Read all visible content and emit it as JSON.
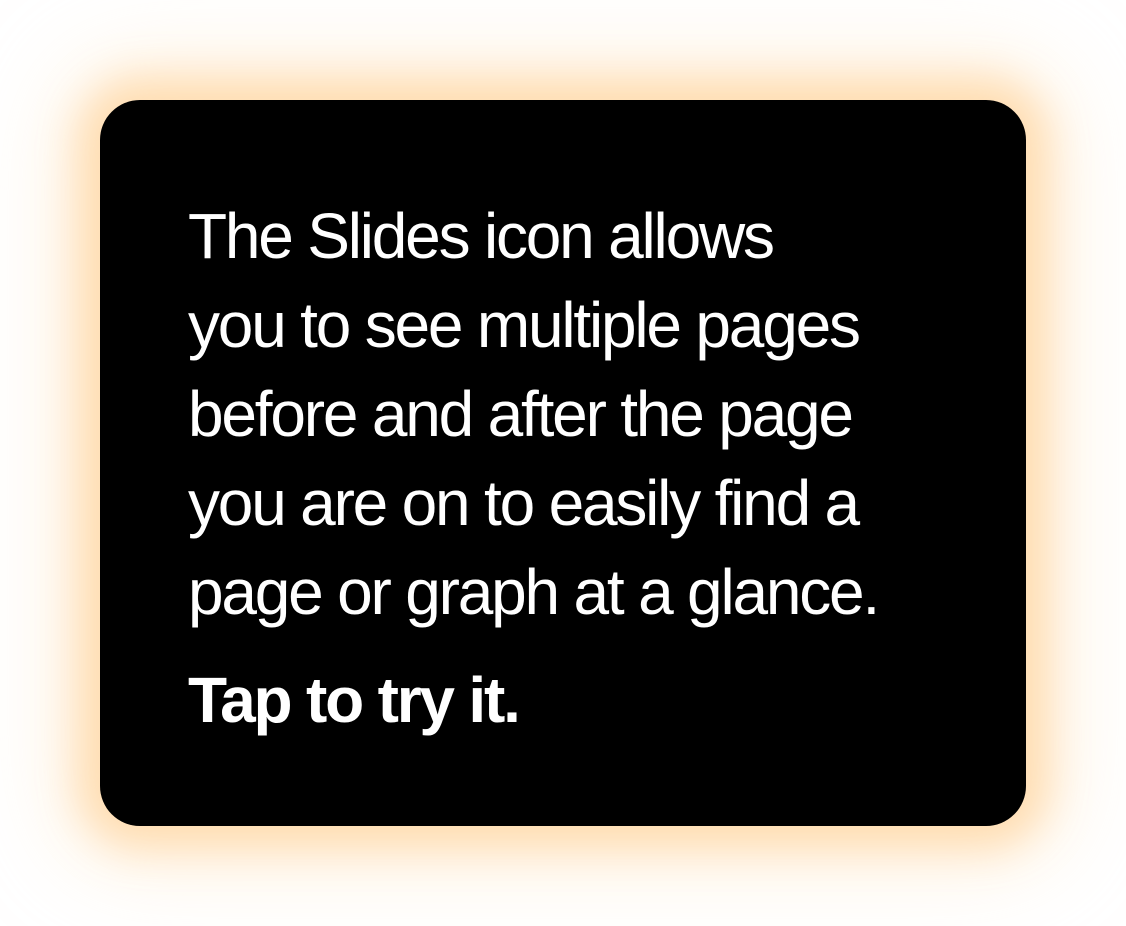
{
  "tooltip": {
    "body_lines": [
      "The Slides icon allows",
      "you to see multiple pages",
      "before and after the page",
      "you are on to easily find a",
      "page or graph at a glance."
    ],
    "cta": "Tap to try it."
  },
  "colors": {
    "card_background": "#000000",
    "text": "#ffffff",
    "glow": "#FFD6A0",
    "page_background": "#ffffff"
  }
}
